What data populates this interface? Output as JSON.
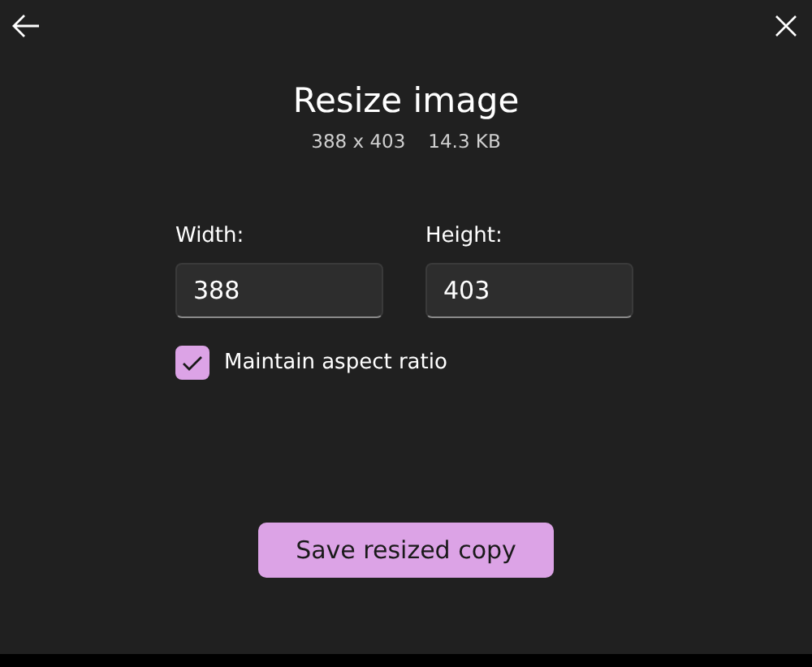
{
  "dialog": {
    "title": "Resize image",
    "dimensions": "388 x 403",
    "file_size": "14.3 KB"
  },
  "fields": [
    {
      "label": "Width:",
      "value": "388"
    },
    {
      "label": "Height:",
      "value": "403"
    }
  ],
  "aspect_ratio": {
    "label": "Maintain aspect ratio",
    "checked": true
  },
  "button": {
    "label": "Save resized copy"
  }
}
